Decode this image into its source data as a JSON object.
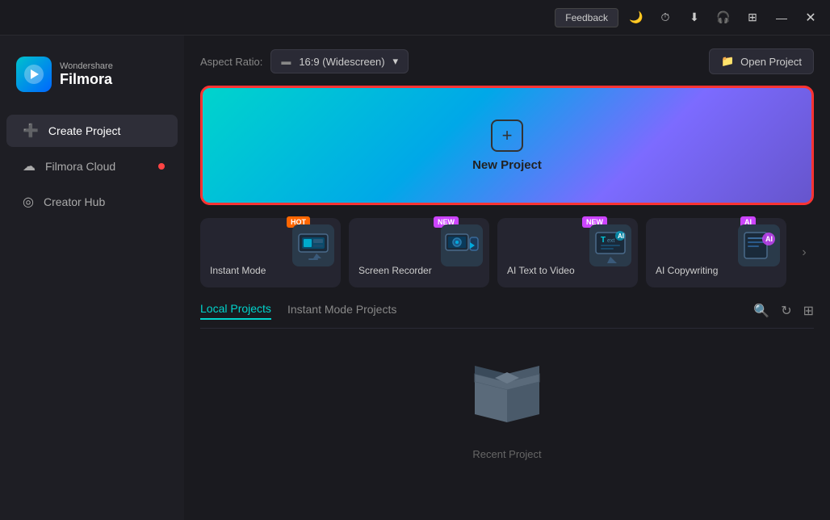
{
  "titlebar": {
    "feedback_label": "Feedback",
    "minimize_label": "—",
    "close_label": "✕"
  },
  "sidebar": {
    "logo_top": "Wondershare",
    "logo_bottom": "Filmora",
    "items": [
      {
        "id": "create-project",
        "label": "Create Project",
        "icon": "➕",
        "active": true
      },
      {
        "id": "filmora-cloud",
        "label": "Filmora Cloud",
        "icon": "☁",
        "active": false,
        "dot": true
      },
      {
        "id": "creator-hub",
        "label": "Creator Hub",
        "icon": "◎",
        "active": false
      }
    ]
  },
  "top_bar": {
    "aspect_ratio_label": "Aspect Ratio:",
    "aspect_ratio_value": "16:9 (Widescreen)",
    "open_project_label": "Open Project"
  },
  "new_project": {
    "label": "New Project"
  },
  "feature_cards": [
    {
      "id": "instant-mode",
      "label": "Instant Mode",
      "badge": "HOT",
      "badge_type": "hot",
      "icon": "🖥"
    },
    {
      "id": "screen-recorder",
      "label": "Screen Recorder",
      "badge": "NEW",
      "badge_type": "new",
      "icon": "📹"
    },
    {
      "id": "ai-text-to-video",
      "label": "AI Text to Video",
      "badge": "NEW",
      "badge_type": "new",
      "icon": "🎬"
    },
    {
      "id": "ai-copywriting",
      "label": "AI Copywriting",
      "badge": "AI",
      "badge_type": "new",
      "icon": "✍"
    }
  ],
  "projects": {
    "tabs": [
      {
        "id": "local",
        "label": "Local Projects",
        "active": true
      },
      {
        "id": "instant",
        "label": "Instant Mode Projects",
        "active": false
      }
    ],
    "empty_label": "Recent Project"
  }
}
